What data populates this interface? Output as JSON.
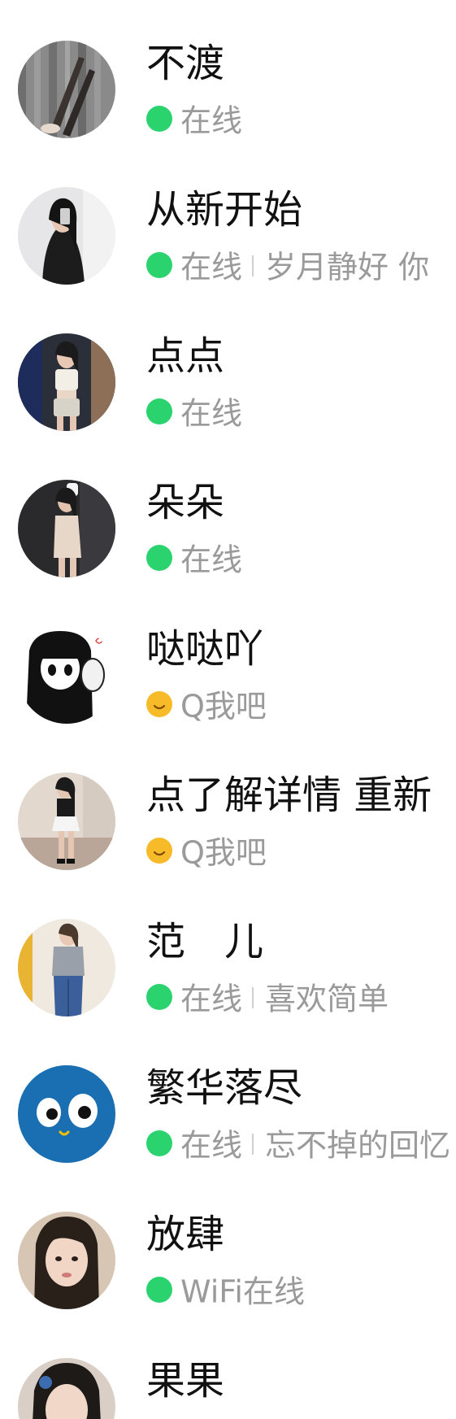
{
  "contacts": [
    {
      "name": "不渡",
      "status_icon": "online-dot-icon",
      "status": "在线",
      "signature": ""
    },
    {
      "name": "从新开始",
      "status_icon": "online-dot-icon",
      "status": "在线",
      "signature": "岁月静好  你"
    },
    {
      "name": "点点",
      "status_icon": "online-dot-icon",
      "status": "在线",
      "signature": ""
    },
    {
      "name": "朵朵",
      "status_icon": "online-dot-icon",
      "status": "在线",
      "signature": ""
    },
    {
      "name": "哒哒吖",
      "status_icon": "smile-icon",
      "status": "Q我吧",
      "signature": ""
    },
    {
      "name": "点了解详情 重新",
      "status_icon": "smile-icon",
      "status": "Q我吧",
      "signature": ""
    },
    {
      "name": "范　儿",
      "status_icon": "online-dot-icon",
      "status": "在线",
      "signature": "喜欢简单"
    },
    {
      "name": "繁华落尽",
      "status_icon": "online-dot-icon",
      "status": "在线",
      "signature": "忘不掉的回忆"
    },
    {
      "name": "放肆",
      "status_icon": "online-dot-icon",
      "status": "WiFi在线",
      "signature": ""
    },
    {
      "name": "果果",
      "status_icon": "",
      "status": "",
      "signature": ""
    }
  ],
  "colors": {
    "online": "#2bd36f",
    "smile": "#f7bb29",
    "name_text": "#111111",
    "secondary_text": "#9a9a9a",
    "blue_avatar": "#1a6fb3"
  }
}
